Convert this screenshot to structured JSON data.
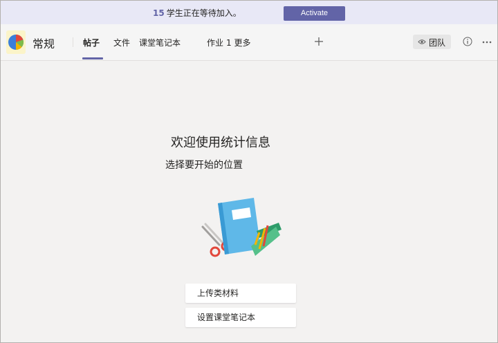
{
  "banner": {
    "count": "15",
    "message": "学生正在等待加入。",
    "activate_label": "Activate"
  },
  "header": {
    "channel_name": "常规",
    "tabs": [
      {
        "label": "帖子",
        "active": true
      },
      {
        "label": "文件",
        "active": false
      },
      {
        "label": "课堂笔记本",
        "active": false
      },
      {
        "label": "作业",
        "active": false
      },
      {
        "label": "1 更多",
        "active": false
      }
    ],
    "team_button_label": "团队",
    "icons": {
      "team": "pie-chart-icon",
      "add": "plus-icon",
      "team_view": "eye-icon",
      "info": "info-icon",
      "more": "more-icon"
    }
  },
  "main": {
    "title": "欢迎使用统计信息",
    "subtitle": "选择要开始的位置",
    "illustration": "notebook-scissors-pencils-illustration",
    "actions": [
      {
        "label": "上传类材料"
      },
      {
        "label": "设置课堂笔记本"
      }
    ]
  },
  "colors": {
    "accent": "#6264a7",
    "banner_bg": "#e8e8f6",
    "page_bg": "#f3f2f1"
  }
}
